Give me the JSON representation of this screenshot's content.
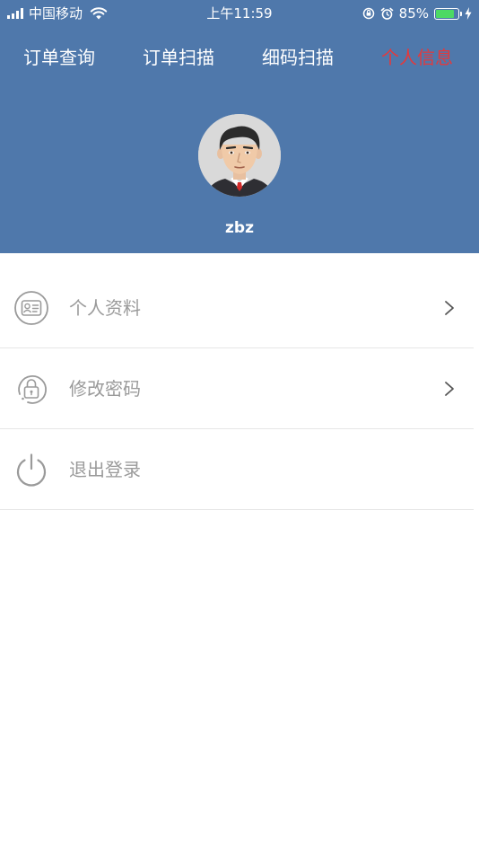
{
  "status_bar": {
    "carrier": "中国移动",
    "time": "上午11:59",
    "battery_percent_text": "85%",
    "battery_level": 0.85,
    "icons": [
      "signal-icon",
      "wifi-icon",
      "orientation-lock-icon",
      "alarm-icon",
      "battery-icon",
      "charging-icon"
    ]
  },
  "nav": {
    "tabs": [
      {
        "label": "订单查询",
        "active": false
      },
      {
        "label": "订单扫描",
        "active": false
      },
      {
        "label": "细码扫描",
        "active": false
      },
      {
        "label": "个人信息",
        "active": true
      }
    ]
  },
  "profile": {
    "username": "zbz",
    "avatar": "cartoon-man-avatar"
  },
  "menu": {
    "items": [
      {
        "label": "个人资料",
        "icon": "id-card-icon",
        "has_arrow": true
      },
      {
        "label": "修改密码",
        "icon": "lock-icon",
        "has_arrow": true
      },
      {
        "label": "退出登录",
        "icon": "power-icon",
        "has_arrow": false
      }
    ]
  },
  "colors": {
    "header_bg": "#4f78ab",
    "active_tab": "#e4393c",
    "menu_text": "#9a9a9a",
    "divider": "#e6e6e6",
    "battery_fill": "#4cd964"
  }
}
